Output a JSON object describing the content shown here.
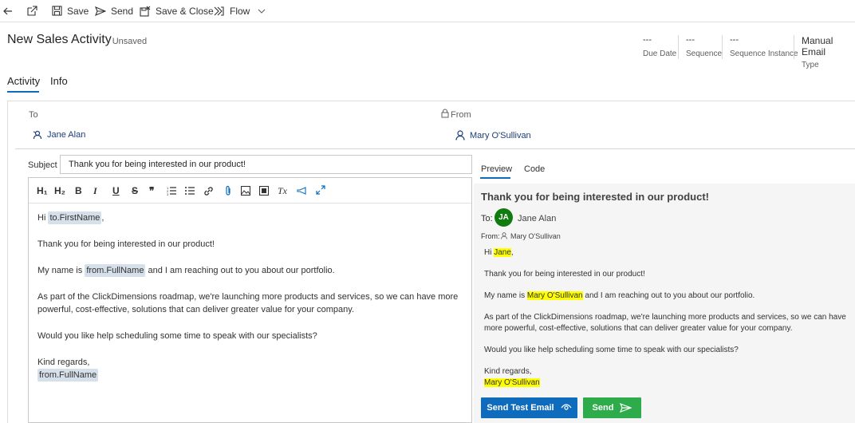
{
  "commandbar": {
    "back_label": "Back",
    "save_label": "Save",
    "send_label": "Send",
    "save_close_label": "Save & Close",
    "flow_label": "Flow"
  },
  "header": {
    "title": "New Sales Activity",
    "status": "- Unsaved",
    "fields": [
      {
        "value": "---",
        "label": "Due Date"
      },
      {
        "value": "---",
        "label": "Sequence"
      },
      {
        "value": "---",
        "label": "Sequence Instance"
      },
      {
        "value": "Manual Email",
        "label": "Type"
      }
    ]
  },
  "tabs": [
    {
      "label": "Activity",
      "active": true
    },
    {
      "label": "Info",
      "active": false
    }
  ],
  "form": {
    "to_label": "To",
    "to_value": "Jane Alan",
    "from_label": "From",
    "from_value": "Mary O'Sullivan",
    "subject_label": "Subject",
    "subject_value": "Thank you for being interested in our product!"
  },
  "toolbar": {
    "h1": "H₁",
    "h2": "H₂",
    "bold": "B",
    "italic": "I",
    "underline": "U",
    "strike": "S",
    "quote": "❞",
    "clear": "Tx"
  },
  "editor": {
    "greeting_prefix": "Hi",
    "greeting_token": "to.FirstName",
    "greeting_suffix": ",",
    "line2": "Thank you for being interested in our product!",
    "line3_prefix": "My name is",
    "line3_token": "from.FullName",
    "line3_suffix": "and I am reaching out to you about our portfolio.",
    "line4": "As part of the ClickDimensions roadmap, we're launching more products and services, so we can have more powerful, cost-effective, solutions that can deliver greater value for your company.",
    "line5": "Would you like help scheduling some time to speak with our specialists?",
    "regards": "Kind regards,",
    "signature_token": "from.FullName"
  },
  "preview": {
    "tab_preview": "Preview",
    "tab_code": "Code",
    "subject": "Thank you for being interested in our product!",
    "to_label": "To:",
    "avatar_initials": "JA",
    "to_name": "Jane Alan",
    "from_label": "From:",
    "from_name": "Mary O'Sullivan",
    "greeting_prefix": "Hi",
    "greeting_name": "Jane",
    "greeting_suffix": ",",
    "line2": "Thank you for being interested in our product!",
    "line3_prefix": "My name is",
    "line3_name": "Mary O'Sullivan",
    "line3_suffix": "and I am reaching out to you about our portfolio.",
    "line4": "As part of the ClickDimensions roadmap, we're launching more products and services, so we can have more powerful, cost-effective, solutions that can deliver greater value for your company.",
    "line5": "Would you like help scheduling some time to speak with our specialists?",
    "regards": "Kind regards,",
    "signature": "Mary O'Sullivan"
  },
  "buttons": {
    "send_test": "Send Test Email",
    "send": "Send"
  },
  "colors": {
    "accent": "#0f6cbd",
    "send_test_bg": "#0f6cbd",
    "send_bg": "#2eac4b",
    "highlight": "#ffff00",
    "token_bg": "#d6e0ea",
    "avatar_bg": "#107c10"
  },
  "icons": {
    "back": "back-arrow-icon",
    "popout": "popout-icon",
    "save": "save-icon",
    "send": "send-icon",
    "save_close": "save-close-icon",
    "flow": "flow-icon",
    "chevron": "chevron-down-icon",
    "lock": "lock-icon",
    "contact": "contact-icon",
    "user": "user-icon",
    "eye": "eye-icon"
  }
}
